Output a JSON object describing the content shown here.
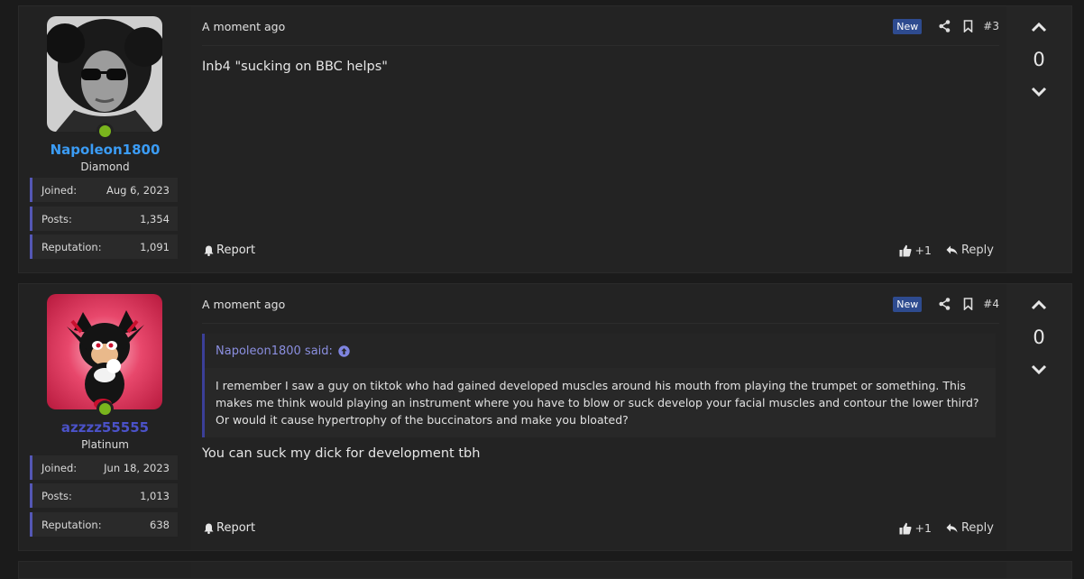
{
  "posts": [
    {
      "username": "Napoleon1800",
      "username_color": "#3b9cf5",
      "user_title": "Diamond",
      "stats": [
        {
          "label": "Joined:",
          "value": "Aug 6, 2023"
        },
        {
          "label": "Posts:",
          "value": "1,354"
        },
        {
          "label": "Reputation:",
          "value": "1,091"
        }
      ],
      "time": "A moment ago",
      "badge": "New",
      "number": "#3",
      "message": "Inb4 \"sucking on BBC helps\"",
      "report": "Report",
      "likes": "+1",
      "reply": "Reply",
      "score": "0",
      "avatar_icon": "avatar-portrait-sunglasses"
    },
    {
      "username": "azzzz55555",
      "username_color": "#4b52c8",
      "user_title": "Platinum",
      "stats": [
        {
          "label": "Joined:",
          "value": "Jun 18, 2023"
        },
        {
          "label": "Posts:",
          "value": "1,013"
        },
        {
          "label": "Reputation:",
          "value": "638"
        }
      ],
      "time": "A moment ago",
      "badge": "New",
      "number": "#4",
      "quote_author": "Napoleon1800 said:",
      "quote_text": "I remember I saw a guy on tiktok who had gained developed muscles around his mouth from playing the trumpet or something. This makes me think would playing an instrument where you have to blow or suck develop your facial muscles and contour the lower third? Or would it cause hypertrophy of the buccinators and make you bloated?",
      "message": "You can suck my dick for development tbh",
      "report": "Report",
      "likes": "+1",
      "reply": "Reply",
      "score": "0",
      "avatar_icon": "avatar-shadow-hedgehog"
    }
  ]
}
